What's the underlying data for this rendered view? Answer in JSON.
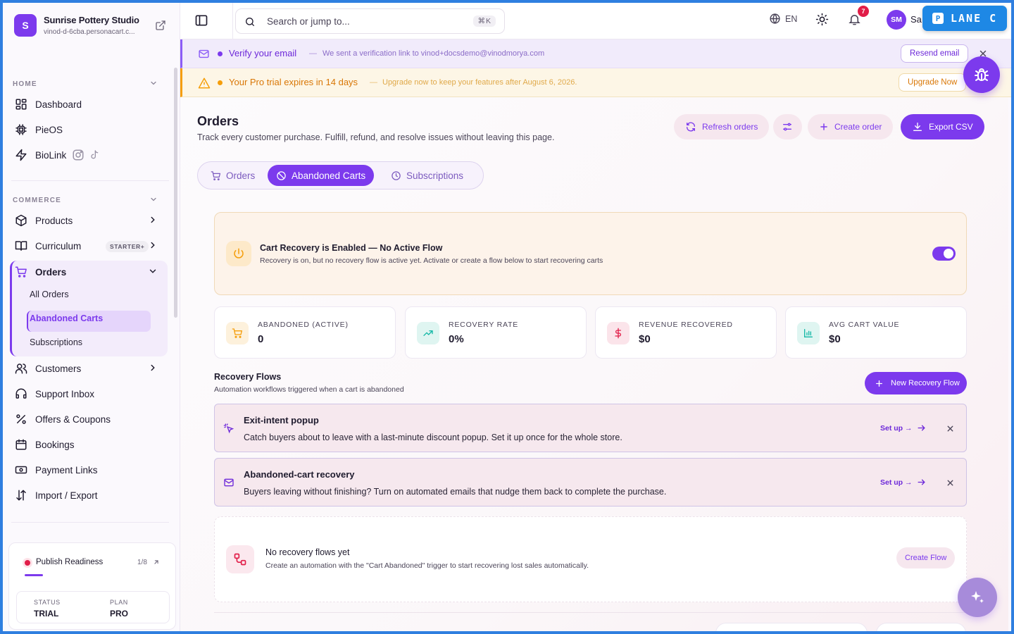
{
  "brand": {
    "logo_letter": "S",
    "name": "Sunrise Pottery Studio",
    "url": "vinod-d-6cba.personacart.c..."
  },
  "sidebar": {
    "home_header": "HOME",
    "commerce_header": "COMMERCE",
    "home_items": [
      {
        "label": "Dashboard",
        "icon": "dashboard-icon"
      },
      {
        "label": "PieOS",
        "icon": "chip-icon"
      },
      {
        "label": "BioLink",
        "icon": "lightning-icon"
      }
    ],
    "commerce_items": [
      {
        "label": "Products",
        "icon": "box-icon"
      },
      {
        "label": "Curriculum",
        "icon": "book-icon",
        "badge": "STARTER+"
      },
      {
        "label": "Orders",
        "icon": "cart-icon"
      }
    ],
    "orders_sub": [
      "All Orders",
      "Abandoned Carts",
      "Subscriptions"
    ],
    "more_items": [
      {
        "label": "Customers",
        "icon": "users-icon"
      },
      {
        "label": "Support Inbox",
        "icon": "headset-icon"
      },
      {
        "label": "Offers & Coupons",
        "icon": "percent-icon"
      },
      {
        "label": "Bookings",
        "icon": "calendar-icon"
      },
      {
        "label": "Payment Links",
        "icon": "payment-link-icon"
      },
      {
        "label": "Import / Export",
        "icon": "import-export-icon"
      }
    ],
    "publish": {
      "label": "Publish Readiness",
      "count": "1/8",
      "status_label": "STATUS",
      "status_value": "TRIAL",
      "plan_label": "PLAN",
      "plan_value": "PRO"
    }
  },
  "topbar": {
    "search_placeholder": "Search or jump to...",
    "search_shortcut": "⌘K",
    "language": "EN",
    "notifications_count": "7",
    "avatar_initials": "SM",
    "user_name_partial": "Sa",
    "lane_label": "LANE C",
    "lane_icon_letter": "P"
  },
  "banners": {
    "verify": {
      "title": "Verify your email",
      "text": "We sent a verification link to vinod+docsdemo@vinodmorya.com",
      "button": "Resend email"
    },
    "trial": {
      "title": "Your Pro trial expires in 14 days",
      "text": "Upgrade now to keep your features after August 6, 2026.",
      "button": "Upgrade Now"
    },
    "separator": "—"
  },
  "page": {
    "title": "Orders",
    "subtitle": "Track every customer purchase. Fulfill, refund, and resolve issues without leaving this page.",
    "buttons": {
      "refresh": "Refresh orders",
      "create": "Create order",
      "export": "Export CSV"
    },
    "tabs": [
      "Orders",
      "Abandoned Carts",
      "Subscriptions"
    ],
    "active_tab": "Abandoned Carts"
  },
  "recovery": {
    "title": "Cart Recovery is Enabled — No Active Flow",
    "text": "Recovery is on, but no recovery flow is active yet. Activate or create a flow below to start recovering carts",
    "enabled": true
  },
  "stats": [
    {
      "label": "ABANDONED (ACTIVE)",
      "value": "0",
      "icon": "cart-icon",
      "color": "#f59e0b",
      "bg": "#fdf1dc"
    },
    {
      "label": "RECOVERY RATE",
      "value": "0%",
      "icon": "trending-up-icon",
      "color": "#14b8a6",
      "bg": "#dff5f1"
    },
    {
      "label": "REVENUE RECOVERED",
      "value": "$0",
      "icon": "dollar-icon",
      "color": "#e11d48",
      "bg": "#fbe4ea"
    },
    {
      "label": "AVG CART VALUE",
      "value": "$0",
      "icon": "bar-chart-icon",
      "color": "#14b8a6",
      "bg": "#dff5f1"
    }
  ],
  "flows": {
    "title": "Recovery Flows",
    "subtitle": "Automation workflows triggered when a cart is abandoned",
    "new_button": "New Recovery Flow",
    "suggestions": [
      {
        "title": "Exit-intent popup",
        "text": "Catch buyers about to leave with a last-minute discount popup. Set it up once for the whole store.",
        "action": "Set up →",
        "icon": "cursor-click-icon"
      },
      {
        "title": "Abandoned-cart recovery",
        "text": "Buyers leaving without finishing? Turn on automated emails that nudge them back to complete the purchase.",
        "action": "Set up →",
        "icon": "mail-icon"
      }
    ],
    "empty": {
      "title": "No recovery flows yet",
      "text": "Create an automation with the \"Cart Abandoned\" trigger to start recovering lost sales automatically.",
      "button": "Create Flow"
    }
  },
  "colors": {
    "accent": "#7c3aed",
    "frame": "#2f7fe0",
    "warning": "#f59e0b",
    "danger": "#e11d48"
  }
}
